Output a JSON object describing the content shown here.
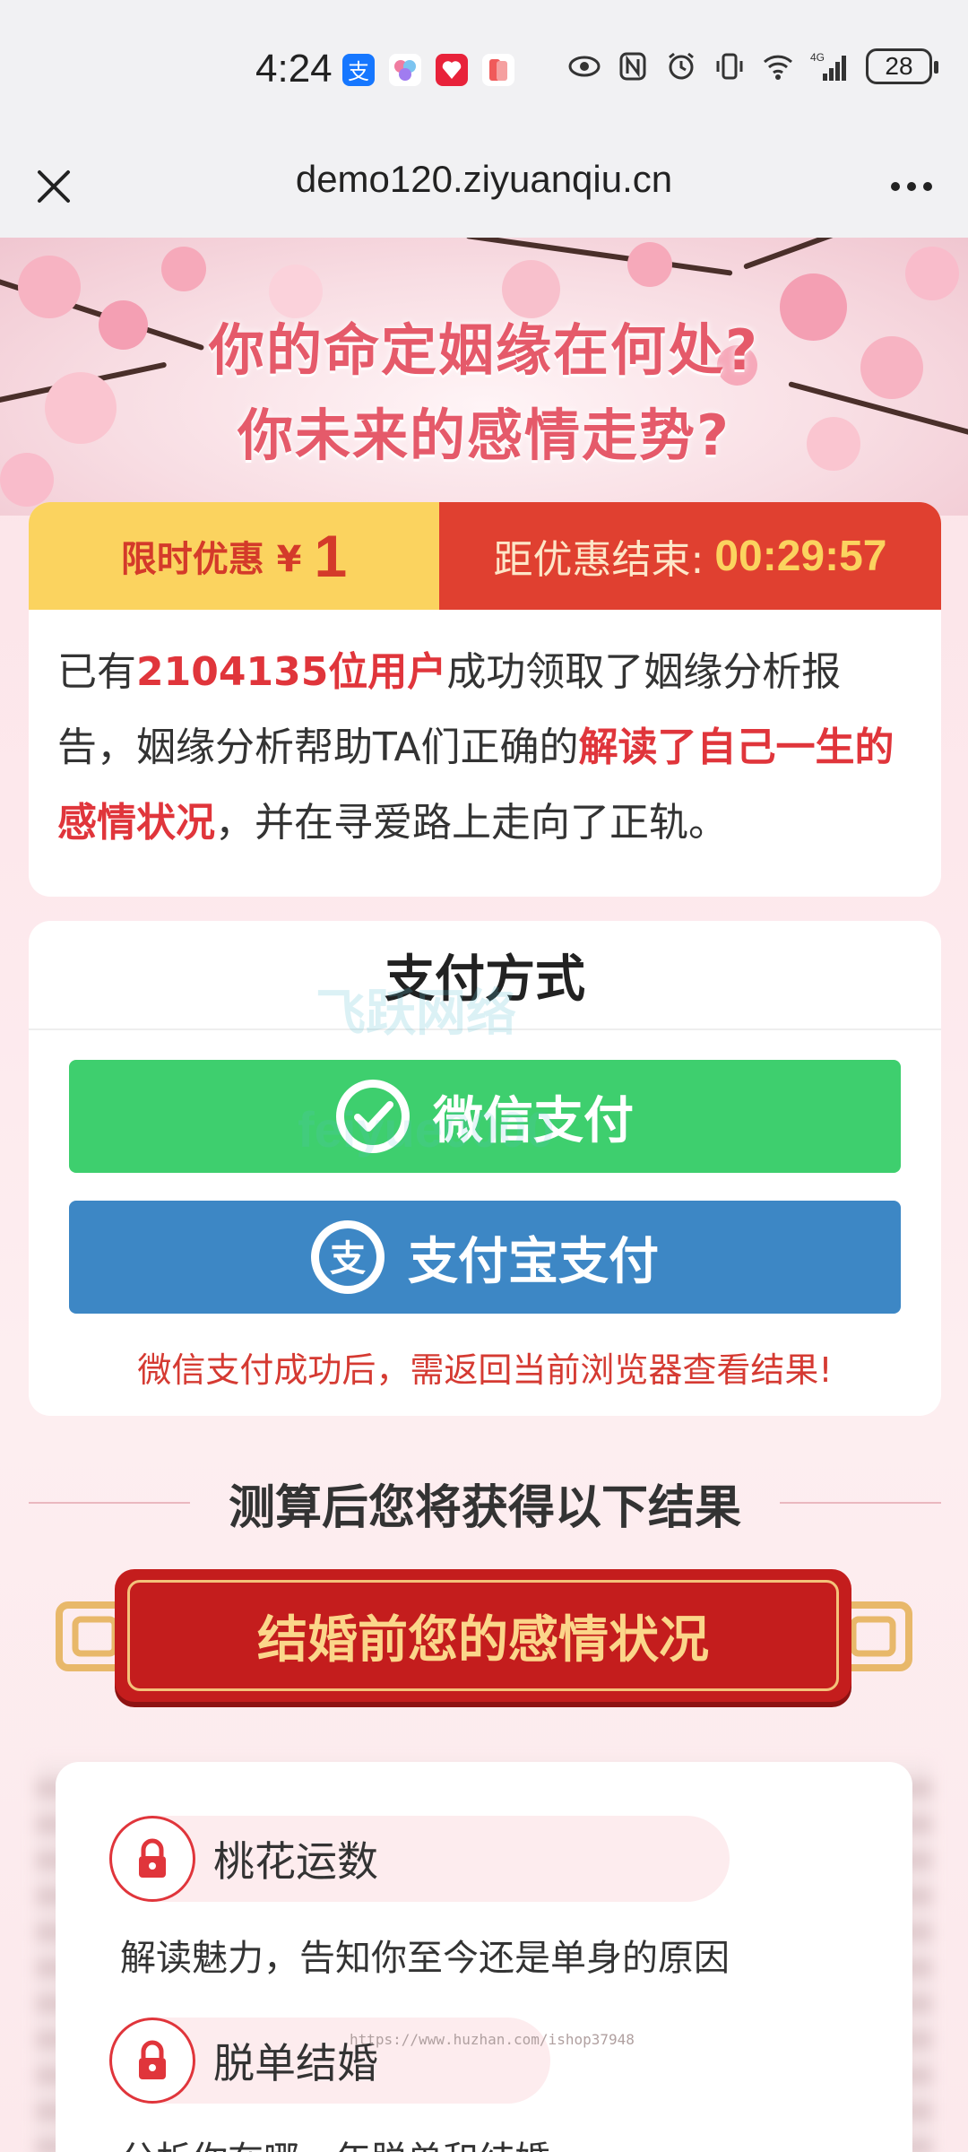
{
  "status_bar": {
    "time": "4:24",
    "battery": "28",
    "network": "4G",
    "icons": [
      "alipay-app-icon",
      "app-icon",
      "app-icon",
      "app-icon",
      "eye-icon",
      "nfc-icon",
      "alarm-icon",
      "vibrate-icon",
      "wifi-icon",
      "signal-icon"
    ]
  },
  "browser": {
    "url": "demo120.ziyuanqiu.cn",
    "close_icon": "close-icon",
    "more_icon": "more-icon"
  },
  "banner": {
    "headline_1": "你的命定姻缘在何处?",
    "headline_2": "你未来的感情走势?"
  },
  "promo": {
    "label": "限时优惠 ¥",
    "price": "1",
    "countdown_label": "距优惠结束:",
    "countdown": "00:29:57",
    "text": {
      "p1": "已有",
      "users": "2104135位用户",
      "p2": "成功领取了姻缘分析报告，姻缘分析帮助TA们正确的",
      "highlight": "解读了自己一生的感情状况",
      "p3": "，并在寻爱路上走向了正轨。"
    }
  },
  "payment": {
    "title": "支付方式",
    "wechat_label": "微信支付",
    "alipay_label": "支付宝支付",
    "note": "微信支付成功后，需返回当前浏览器查看结果!",
    "watermark_1": "飞跃网络",
    "watermark_2": "feiyue0000",
    "colors": {
      "wechat": "#3ecf6e",
      "alipay": "#3d87c5"
    }
  },
  "results": {
    "section_title": "测算后您将获得以下结果",
    "ribbon_title": "结婚前您的感情状况",
    "items": [
      {
        "title": "桃花运数",
        "desc": "解读魅力，告知你至今还是单身的原因"
      },
      {
        "title": "脱单结婚",
        "desc": "分析你在哪一年脱单和结婚"
      }
    ],
    "watermark_url": "https://www.huzhan.com/ishop37948"
  },
  "colors": {
    "accent_red": "#e0353b",
    "promo_yellow": "#fbd35f",
    "ribbon_red": "#c41d1d"
  }
}
